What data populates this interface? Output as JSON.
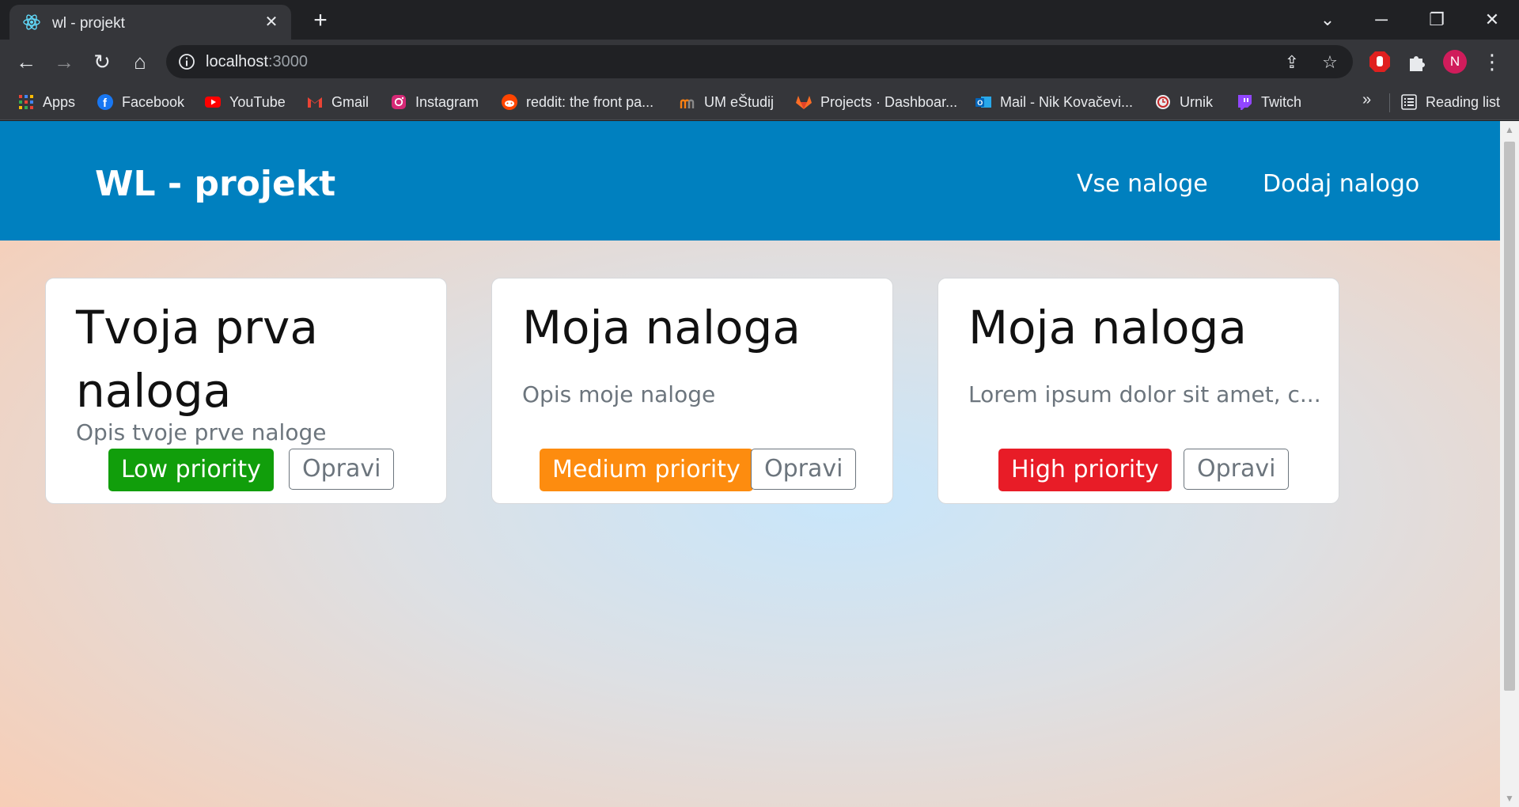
{
  "browser": {
    "tab": {
      "title": "wl - projekt"
    },
    "omnibox": {
      "host": "localhost",
      "port": ":3000"
    },
    "profile_initial": "N",
    "bookmarks": [
      {
        "label": "Apps",
        "icon": "apps-grid-icon"
      },
      {
        "label": "Facebook",
        "icon": "facebook-icon"
      },
      {
        "label": "YouTube",
        "icon": "youtube-icon"
      },
      {
        "label": "Gmail",
        "icon": "gmail-icon"
      },
      {
        "label": "Instagram",
        "icon": "instagram-icon"
      },
      {
        "label": "reddit: the front pa...",
        "icon": "reddit-icon"
      },
      {
        "label": "UM eŠtudij",
        "icon": "moodle-icon"
      },
      {
        "label": "Projects · Dashboar...",
        "icon": "gitlab-icon"
      },
      {
        "label": "Mail - Nik Kovačevi...",
        "icon": "outlook-icon"
      },
      {
        "label": "Urnik",
        "icon": "urnik-icon"
      },
      {
        "label": "Twitch",
        "icon": "twitch-icon"
      }
    ],
    "bookmarks_overflow": "»",
    "reading_list": "Reading list"
  },
  "app": {
    "brand": "WL - projekt",
    "nav": [
      "Vse naloge",
      "Dodaj nalogo"
    ],
    "cards": [
      {
        "title": "Tvoja prva naloga",
        "description": "Opis tvoje prve naloge",
        "priority": "Low priority",
        "priority_color": "#119e0b",
        "button": "Opravi"
      },
      {
        "title": "Moja naloga",
        "description": "Opis moje naloge",
        "priority": "Medium priority",
        "priority_color": "#fd8c0f",
        "button": "Opravi"
      },
      {
        "title": "Moja naloga",
        "description": "Lorem ipsum dolor sit amet, c...",
        "priority": "High priority",
        "priority_color": "#e81c27",
        "button": "Opravi"
      }
    ]
  }
}
